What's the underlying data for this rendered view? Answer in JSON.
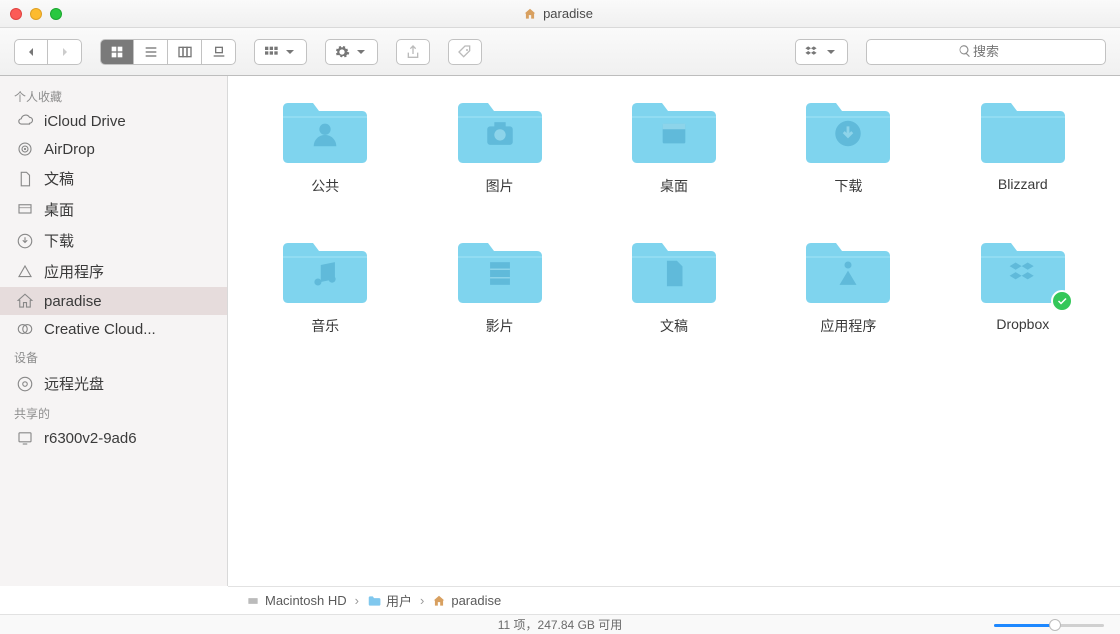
{
  "window": {
    "title": "paradise"
  },
  "sidebar": {
    "sections": [
      {
        "header": "个人收藏",
        "items": [
          {
            "icon": "cloud",
            "label": "iCloud Drive"
          },
          {
            "icon": "airdrop",
            "label": "AirDrop"
          },
          {
            "icon": "doc",
            "label": "文稿"
          },
          {
            "icon": "desktop",
            "label": "桌面"
          },
          {
            "icon": "download",
            "label": "下载"
          },
          {
            "icon": "app",
            "label": "应用程序"
          },
          {
            "icon": "home",
            "label": "paradise",
            "selected": true
          },
          {
            "icon": "cc",
            "label": "Creative Cloud..."
          }
        ]
      },
      {
        "header": "设备",
        "items": [
          {
            "icon": "disc",
            "label": "远程光盘"
          }
        ]
      },
      {
        "header": "共享的",
        "items": [
          {
            "icon": "monitor",
            "label": "r6300v2-9ad6"
          }
        ]
      }
    ]
  },
  "folders": [
    {
      "label": "公共",
      "glyph": "person"
    },
    {
      "label": "图片",
      "glyph": "camera"
    },
    {
      "label": "桌面",
      "glyph": "window"
    },
    {
      "label": "下载",
      "glyph": "download"
    },
    {
      "label": "Blizzard",
      "glyph": ""
    },
    {
      "label": "音乐",
      "glyph": "music"
    },
    {
      "label": "影片",
      "glyph": "film"
    },
    {
      "label": "文稿",
      "glyph": "doc"
    },
    {
      "label": "应用程序",
      "glyph": "app"
    },
    {
      "label": "Dropbox",
      "glyph": "dropbox",
      "badge": "check"
    }
  ],
  "path": [
    {
      "icon": "hd",
      "label": "Macintosh HD"
    },
    {
      "icon": "folder",
      "label": "用户"
    },
    {
      "icon": "home",
      "label": "paradise"
    }
  ],
  "status": {
    "count_text": "11 项，",
    "space_text": "247.84 GB 可用"
  },
  "search": {
    "placeholder": "搜索"
  }
}
